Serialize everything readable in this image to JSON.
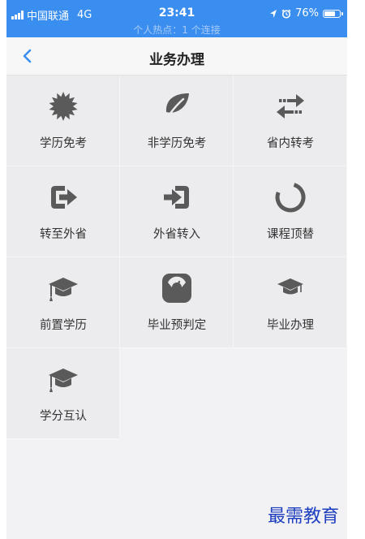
{
  "status_bar": {
    "carrier": "中国联通",
    "network": "4G",
    "time": "23:41",
    "hotspot": "个人热点：1 个连接",
    "battery": "76%",
    "battery_level": 0.76
  },
  "nav": {
    "title": "业务办理",
    "back_icon": "chevron-left-icon"
  },
  "menu": [
    {
      "label": "学历免考",
      "icon": "starburst-icon"
    },
    {
      "label": "非学历免考",
      "icon": "leaf-icon"
    },
    {
      "label": "省内转考",
      "icon": "swap-arrows-icon"
    },
    {
      "label": "转至外省",
      "icon": "exit-arrow-icon"
    },
    {
      "label": "外省转入",
      "icon": "enter-arrow-icon"
    },
    {
      "label": "课程顶替",
      "icon": "circle-notch-icon"
    },
    {
      "label": "前置学历",
      "icon": "graduation-cap-icon"
    },
    {
      "label": "毕业预判定",
      "icon": "scale-icon"
    },
    {
      "label": "毕业办理",
      "icon": "graduation-cap-small-icon"
    },
    {
      "label": "学分互认",
      "icon": "graduation-cap-icon"
    }
  ],
  "colors": {
    "accent": "#3a8ef0",
    "icon": "#5a5a5a"
  },
  "watermark": "最需教育"
}
